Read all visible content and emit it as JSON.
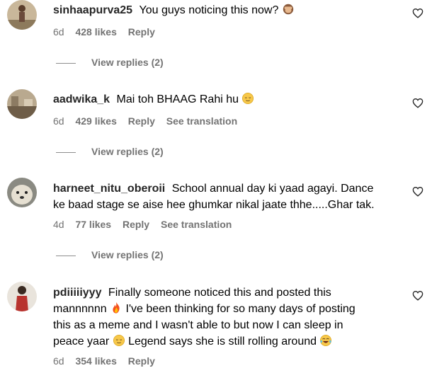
{
  "comments": [
    {
      "username": "sinhaapurva25",
      "text": "You guys noticing this now?",
      "emoji_end": "see-no-evil-monkey",
      "time": "6d",
      "likes": "428 likes",
      "reply": "Reply",
      "view_replies": "View replies (2)"
    },
    {
      "username": "aadwika_k",
      "text": "Mai toh BHAAG Rahi hu",
      "emoji_end": "relieved-face",
      "time": "6d",
      "likes": "429 likes",
      "reply": "Reply",
      "translation": "See translation",
      "view_replies": "View replies (2)"
    },
    {
      "username": "harneet_nitu_oberoii",
      "text_line1": "School annual day ki yaad agayi. Dance",
      "text_line2": "ke baad stage se aise hee ghumkar nikal jaate thhe.....Ghar tak.",
      "time": "4d",
      "likes": "77 likes",
      "reply": "Reply",
      "translation": "See translation",
      "view_replies": "View replies (2)"
    },
    {
      "username": "pdiiiiiyyy",
      "text_line1": "Finally someone noticed this and posted this",
      "text_line2a": "mannnnnn",
      "text_line2b": "I've been thinking for so many days of posting",
      "text_line3": "this as a meme and I wasn't able to but now I can sleep in",
      "text_line4a": "peace yaar",
      "text_line4b": "Legend says she is still rolling around",
      "time": "6d",
      "likes": "354 likes",
      "reply": "Reply"
    }
  ],
  "colors": {
    "username": "#262626",
    "meta": "#737373",
    "heart": "#262626"
  }
}
